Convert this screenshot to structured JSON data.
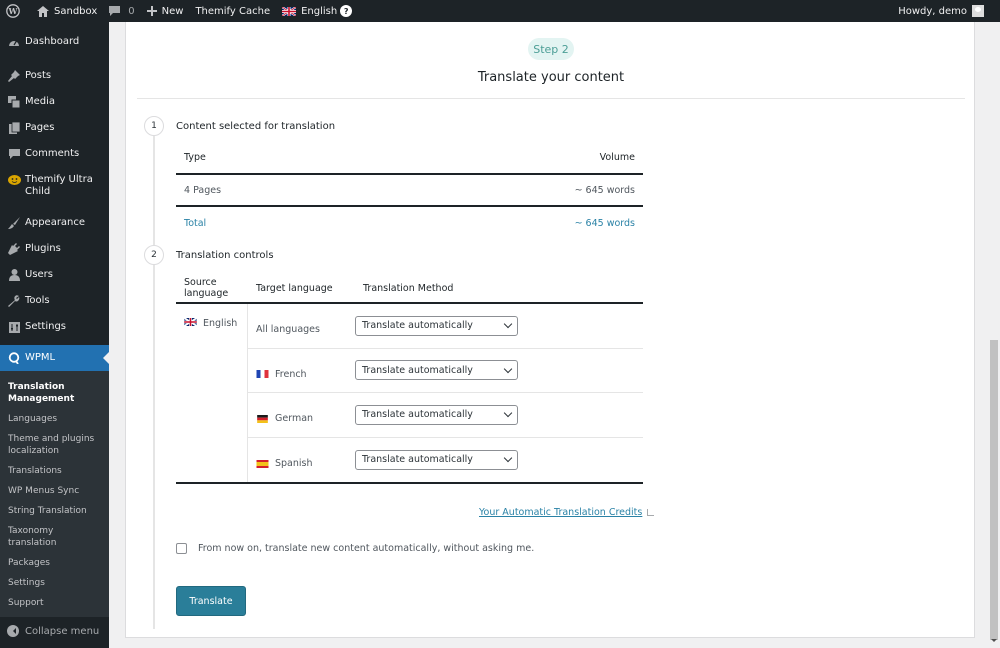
{
  "admin_bar": {
    "site_name": "Sandbox",
    "comments_count": "0",
    "new_label": "New",
    "themify_cache": "Themify Cache",
    "language": "English",
    "help": "?",
    "greeting": "Howdy, demo"
  },
  "sidebar": {
    "items": [
      {
        "label": "Dashboard",
        "icon": "dashboard-icon"
      },
      {
        "label": "Posts",
        "icon": "pin-icon"
      },
      {
        "label": "Media",
        "icon": "media-icon"
      },
      {
        "label": "Pages",
        "icon": "pages-icon"
      },
      {
        "label": "Comments",
        "icon": "comment-icon"
      },
      {
        "label": "Themify Ultra Child",
        "icon": "themify-icon"
      },
      {
        "label": "Appearance",
        "icon": "brush-icon"
      },
      {
        "label": "Plugins",
        "icon": "plugin-icon"
      },
      {
        "label": "Users",
        "icon": "user-icon"
      },
      {
        "label": "Tools",
        "icon": "wrench-icon"
      },
      {
        "label": "Settings",
        "icon": "settings-icon"
      },
      {
        "label": "WPML",
        "icon": "wpml-icon"
      }
    ],
    "submenu": [
      "Translation Management",
      "Languages",
      "Theme and plugins localization",
      "Translations",
      "WP Menus Sync",
      "String Translation",
      "Taxonomy translation",
      "Packages",
      "Settings",
      "Support"
    ],
    "collapse_label": "Collapse menu"
  },
  "main": {
    "step_pill": "Step 2",
    "title": "Translate your content",
    "section1": {
      "number": "1",
      "title": "Content selected for translation",
      "col_type": "Type",
      "col_volume": "Volume",
      "rows": [
        {
          "type": "4 Pages",
          "volume": "~ 645 words"
        }
      ],
      "total_label": "Total",
      "total_volume": "~ 645 words"
    },
    "section2": {
      "number": "2",
      "title": "Translation controls",
      "col_source": "Source language",
      "col_target": "Target language",
      "col_method": "Translation Method",
      "source_language": "English",
      "targets": [
        {
          "language": "All languages",
          "method": "Translate automatically"
        },
        {
          "language": "French",
          "method": "Translate automatically"
        },
        {
          "language": "German",
          "method": "Translate automatically"
        },
        {
          "language": "Spanish",
          "method": "Translate automatically"
        }
      ]
    },
    "credits_link": "Your Automatic Translation Credits",
    "auto_checkbox_label": "From now on, translate new content automatically, without asking me.",
    "auto_checkbox_checked": false,
    "translate_button": "Translate"
  },
  "colors": {
    "accent": "#2a7e99",
    "link": "#2a82a6",
    "wp_blue": "#2271b1",
    "adminbar": "#1d2327"
  }
}
